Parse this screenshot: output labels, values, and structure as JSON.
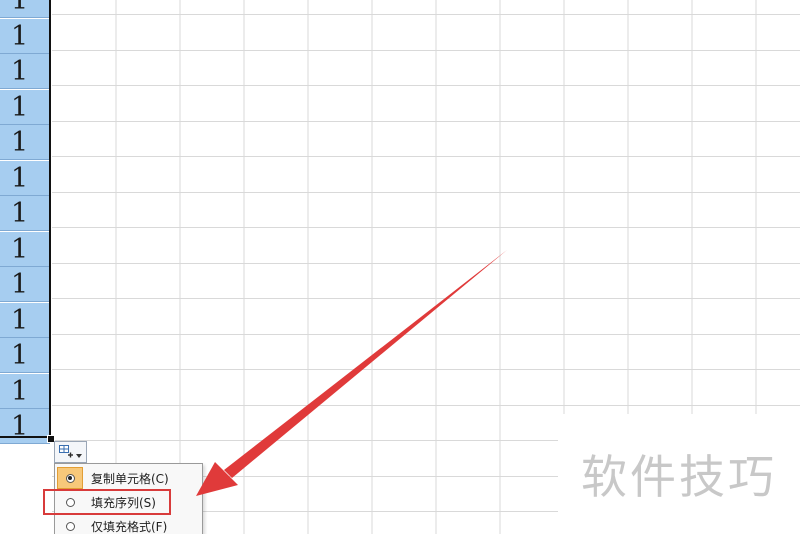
{
  "sheet": {
    "selected_cells": [
      "1",
      "1",
      "1",
      "1",
      "1",
      "1",
      "1",
      "1",
      "1",
      "1",
      "1",
      "1",
      "1"
    ]
  },
  "autofill_options": {
    "button_icon": "autofill-options-icon",
    "items": [
      {
        "label": "复制单元格(C)",
        "checked": true
      },
      {
        "label": "填充序列(S)",
        "checked": false
      },
      {
        "label": "仅填充格式(F)",
        "checked": false
      }
    ]
  },
  "annotation": {
    "arrow_color": "#e03a3a",
    "highlight_color": "#d83b3b"
  },
  "watermark": {
    "text": "软件技巧"
  },
  "colors": {
    "selection_fill": "#a6cdf0",
    "gridline": "#d9d9d9",
    "menu_checked": "#f7c87a"
  }
}
